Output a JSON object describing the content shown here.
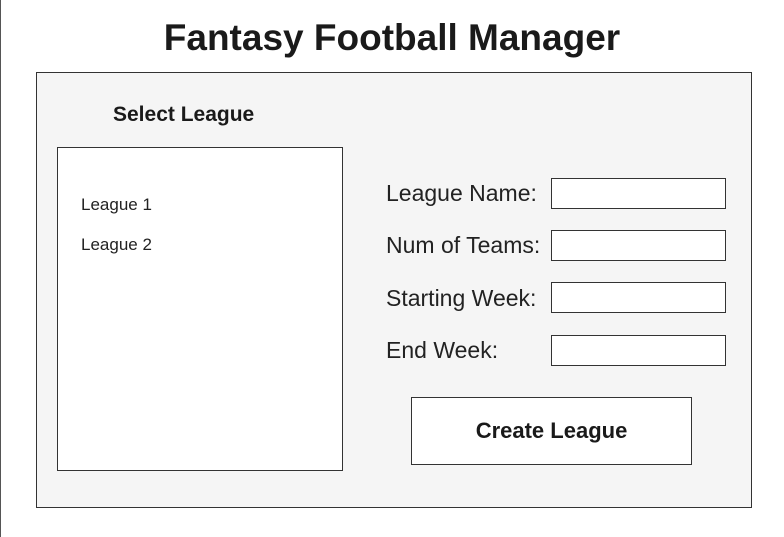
{
  "app": {
    "title": "Fantasy Football Manager"
  },
  "league_picker": {
    "label": "Select League",
    "items": [
      "League 1",
      "League 2"
    ]
  },
  "form": {
    "fields": [
      {
        "label": "League Name:",
        "value": ""
      },
      {
        "label": "Num of Teams:",
        "value": ""
      },
      {
        "label": "Starting Week:",
        "value": ""
      },
      {
        "label": "End Week:",
        "value": ""
      }
    ],
    "submit_label": "Create League"
  },
  "colors": {
    "panel_background": "#f5f5f5",
    "border": "#333333",
    "text": "#1a1a1a"
  }
}
